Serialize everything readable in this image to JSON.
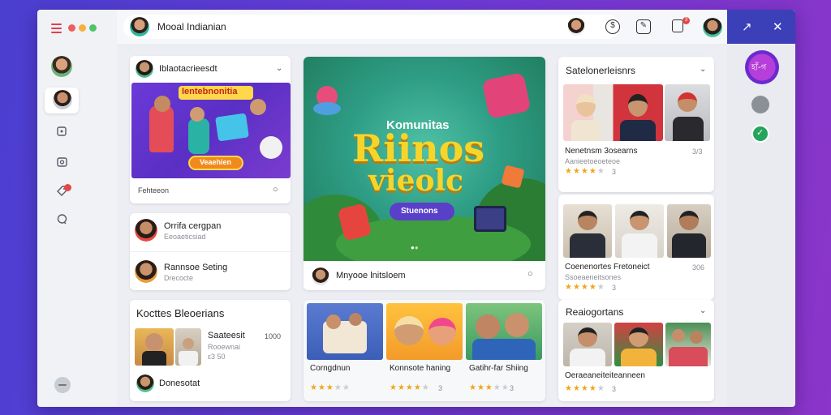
{
  "app": {
    "search_text": "Mooal Indianian",
    "notification_count": "3"
  },
  "right_panel": {
    "logo_text": "হাঁ-গ"
  },
  "left_col": {
    "card1_title": "Iblaotacrieesdt",
    "banner_title": "Ientebnonitia",
    "banner_button": "Veaehien",
    "card1_footer": "Fehteeon",
    "users": [
      {
        "name": "Orrifa cergpan",
        "sub": "Eeoaeticsiad"
      },
      {
        "name": "Rannsoe Seting",
        "sub": "Drecocte"
      }
    ],
    "creators_title": "Kocttes Bleoerians",
    "creator_item_title": "Saateesit",
    "creator_item_meta": "1000",
    "creator_item_sub1": "Rooewnai",
    "creator_item_sub2": "ε3 50",
    "bottom_user": "Donesotat"
  },
  "hero": {
    "kicker": "Komunitas",
    "title_line1": "Riinos",
    "title_line2": "vieolc",
    "button": "Stuenons",
    "footer_text": "Mnyooe lnitsloem"
  },
  "bottom_row": [
    {
      "title": "Corngdnun",
      "rating": 3,
      "count": ""
    },
    {
      "title": "Konnsote haning",
      "rating": 4,
      "count": "3"
    },
    {
      "title": "Gatihr-far Shiing",
      "rating": 3,
      "count": "3"
    }
  ],
  "right_col": {
    "section1_title": "Satelonerleisnrs",
    "section1_name": "Nenetnsm 3osearns",
    "section1_meta": "3/3",
    "section1_sub": "Aanieetoeoeteoe",
    "section1_rating": 4,
    "section1_count": "3",
    "section2_name": "Coenenortes Fretoneict",
    "section2_meta": "306",
    "section2_sub": "Ssoeaeneitsones",
    "section2_rating": 4,
    "section2_count": "3",
    "section3_title": "Reaiogortans",
    "section3_name": "Oeraeaneiteiteanneen",
    "section3_rating": 4,
    "section3_count": "3"
  },
  "colors": {
    "accent": "#4a3fd0",
    "hero_green": "#2f9c79",
    "star": "#f2a51c"
  }
}
